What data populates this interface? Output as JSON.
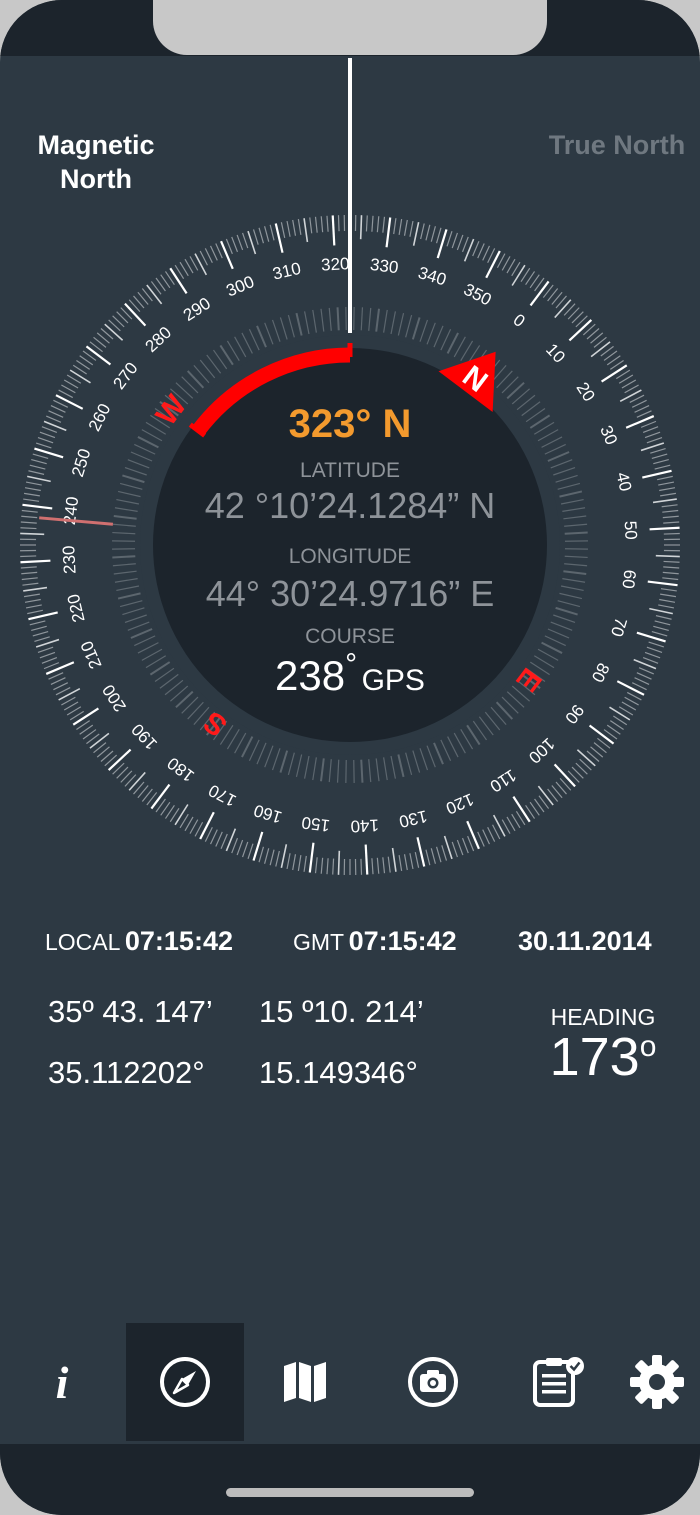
{
  "header": {
    "magnetic_north": "Magnetic North",
    "true_north": "True North"
  },
  "compass": {
    "heading_value": 323,
    "heading_readout": "323° N",
    "cardinals": [
      "N",
      "E",
      "S",
      "W"
    ],
    "latitude_label": "LATITUDE",
    "latitude_value": "42 °10’24.1284” N",
    "longitude_label": "LONGITUDE",
    "longitude_value": "44° 30’24.9716” E",
    "course_label": "COURSE",
    "course_value": "238",
    "course_unit": "°",
    "course_source": "GPS"
  },
  "info": {
    "local_label": "LOCAL",
    "local_time": "07:15:42",
    "gmt_label": "GMT",
    "gmt_time": "07:15:42",
    "date": "30.11.2014",
    "lat_dm": "35º 43. 147’",
    "lon_dm": "15 º10. 214’",
    "lat_decimal": "35.112202°",
    "lon_decimal": "15.149346°",
    "heading_label": "HEADING",
    "heading_value": "173",
    "heading_unit": "o"
  },
  "nav": {
    "info_glyph": "i",
    "selected": "compass",
    "items": [
      "info-icon",
      "compass-icon",
      "map-icon",
      "camera-icon",
      "clipboard-check-icon",
      "gear-icon"
    ]
  },
  "colors": {
    "background": "#2d3943",
    "bar": "#1c242c",
    "accent_orange": "#f39a2e",
    "accent_red": "#ff0000",
    "muted_text": "#8e9399"
  }
}
